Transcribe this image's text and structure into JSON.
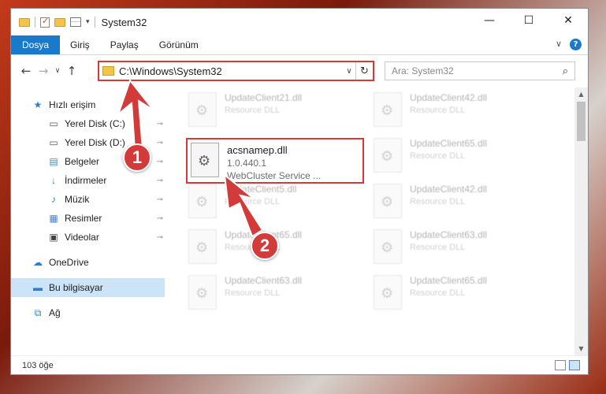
{
  "window": {
    "title": "System32",
    "minimize_glyph": "—",
    "maximize_glyph": "☐",
    "close_glyph": "✕"
  },
  "ribbon": {
    "tabs": [
      "Dosya",
      "Giriş",
      "Paylaş",
      "Görünüm"
    ],
    "expand_glyph": "∨",
    "help_glyph": "?"
  },
  "nav": {
    "back_glyph": "←",
    "forward_glyph": "→",
    "recent_glyph": "∨",
    "up_glyph": "↑",
    "address": "C:\\Windows\\System32",
    "address_dropdown_glyph": "∨",
    "refresh_glyph": "↻",
    "search_placeholder": "Ara: System32",
    "search_glyph": "⌕"
  },
  "sidebar": {
    "items": [
      {
        "label": "Hızlı erişim",
        "icon": "star-icon",
        "glyph": "★",
        "color": "#2d7dd2",
        "pinned": false
      },
      {
        "label": "Yerel Disk (C:)",
        "icon": "drive-icon",
        "glyph": "▭",
        "color": "#555555",
        "pinned": true
      },
      {
        "label": "Yerel Disk (D:)",
        "icon": "drive-icon",
        "glyph": "▭",
        "color": "#555555",
        "pinned": true
      },
      {
        "label": "Belgeler",
        "icon": "documents-icon",
        "glyph": "▤",
        "color": "#4a7fc1",
        "pinned": true
      },
      {
        "label": "İndirmeler",
        "icon": "download-icon",
        "glyph": "↓",
        "color": "#2d7dd2",
        "pinned": true
      },
      {
        "label": "Müzik",
        "icon": "music-icon",
        "glyph": "♪",
        "color": "#2d7dd2",
        "pinned": true
      },
      {
        "label": "Resimler",
        "icon": "pictures-icon",
        "glyph": "▦",
        "color": "#4a7fc1",
        "pinned": true
      },
      {
        "label": "Videolar",
        "icon": "video-icon",
        "glyph": "▣",
        "color": "#444444",
        "pinned": true
      },
      {
        "label": "OneDrive",
        "icon": "cloud-icon",
        "glyph": "☁",
        "color": "#2d7dd2",
        "pinned": false
      },
      {
        "label": "Bu bilgisayar",
        "icon": "computer-icon",
        "glyph": "▬",
        "color": "#2d7dd2",
        "pinned": false
      },
      {
        "label": "Ağ",
        "icon": "network-icon",
        "glyph": "⧉",
        "color": "#2d7dd2",
        "pinned": false
      }
    ],
    "pin_glyph": "📌"
  },
  "files": [
    {
      "name": "UpdateClient21.dll",
      "desc": "Resource DLL"
    },
    {
      "name": "UpdateClient42.dll",
      "desc": "Resource DLL"
    },
    {
      "name": "UpdateClient65.dll",
      "desc": "Resource DLL"
    },
    {
      "name": "UpdateClient5.dll",
      "desc": "Resource DLL"
    },
    {
      "name": "UpdateClient42.dll",
      "desc": "Resource DLL"
    },
    {
      "name": "UpdateClient65.dll",
      "desc": "Resource DLL"
    },
    {
      "name": "UpdateClient63.dll",
      "desc": "Resource DLL"
    },
    {
      "name": "UpdateClient63.dll",
      "desc": "Resource DLL"
    },
    {
      "name": "UpdateClient65.dll",
      "desc": "Resource DLL"
    }
  ],
  "highlighted_file": {
    "name": "acsnamep.dll",
    "version": "1.0.440.1",
    "description": "WebCluster Service ..."
  },
  "status": {
    "count": "103 öğe"
  },
  "annotations": {
    "step1": "1",
    "step2": "2",
    "color": "#d33b3b"
  }
}
